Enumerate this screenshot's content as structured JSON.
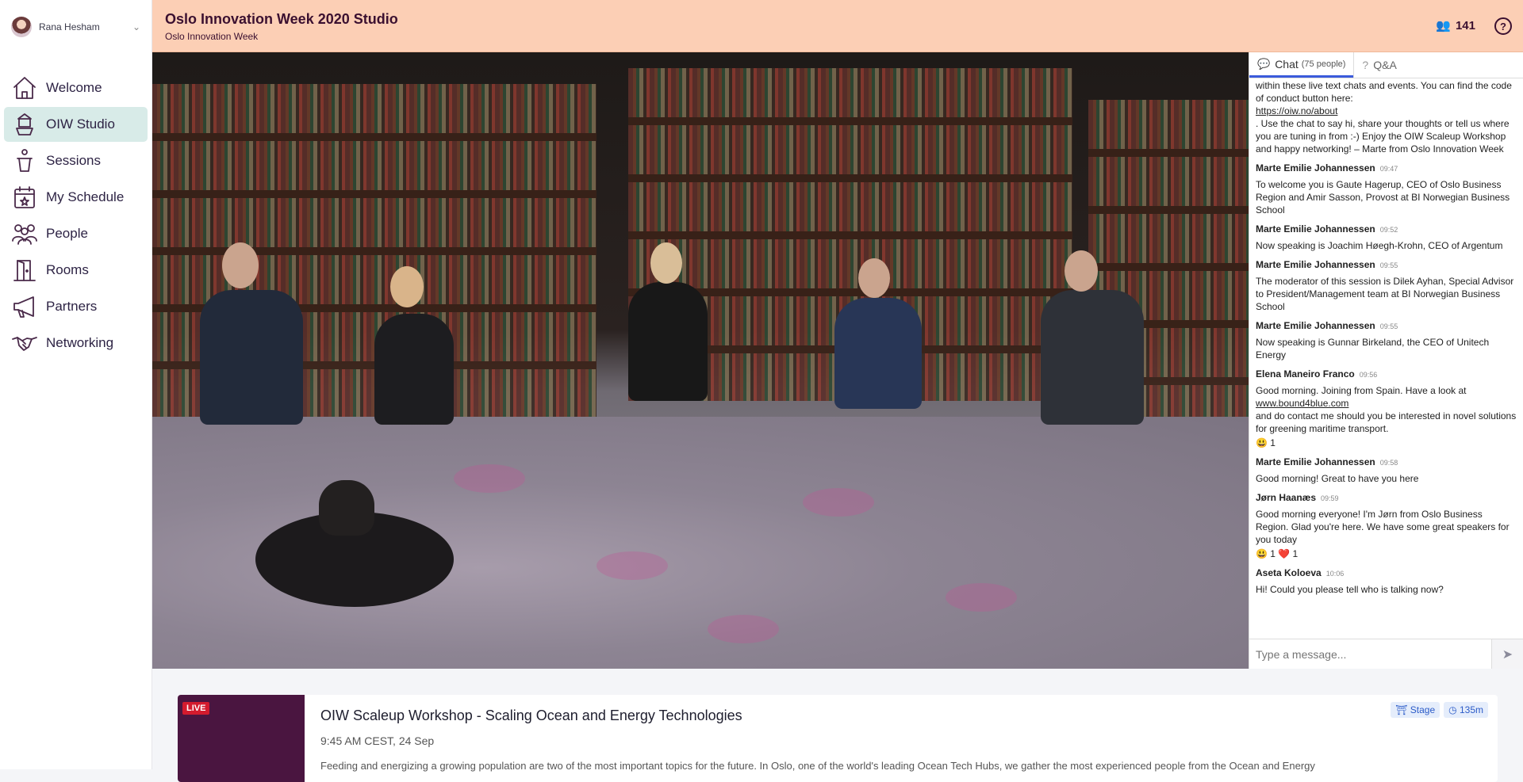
{
  "user": {
    "name": "Rana Hesham"
  },
  "nav": {
    "items": [
      {
        "label": "Welcome",
        "icon": "home-icon"
      },
      {
        "label": "OIW Studio",
        "icon": "stage-icon"
      },
      {
        "label": "Sessions",
        "icon": "podium-icon"
      },
      {
        "label": "My Schedule",
        "icon": "calendar-icon"
      },
      {
        "label": "People",
        "icon": "people-icon"
      },
      {
        "label": "Rooms",
        "icon": "door-icon"
      },
      {
        "label": "Partners",
        "icon": "megaphone-icon"
      },
      {
        "label": "Networking",
        "icon": "handshake-icon"
      }
    ]
  },
  "header": {
    "title": "Oslo Innovation Week 2020 Studio",
    "subtitle": "Oslo Innovation Week",
    "attendee_count": "141"
  },
  "chat": {
    "tab_chat": "Chat",
    "tab_chat_count": "(75 people)",
    "tab_qa": "Q&A",
    "intro": {
      "text_before": "within these live text chats and events. You can find the code of conduct button here:",
      "link": "https://oiw.no/about",
      "text_after": ". Use the chat to say hi, share your thoughts or tell us where you are tuning in from :-) Enjoy the OIW Scaleup Workshop and happy networking! – Marte from Oslo Innovation Week"
    },
    "messages": [
      {
        "author": "Marte Emilie Johannessen",
        "time": "09:47",
        "text": "To welcome you is Gaute Hagerup, CEO of Oslo Business Region and Amir Sasson, Provost at BI Norwegian Business School"
      },
      {
        "author": "Marte Emilie Johannessen",
        "time": "09:52",
        "text": "Now speaking is Joachim Høegh-Krohn, CEO of Argentum"
      },
      {
        "author": "Marte Emilie Johannessen",
        "time": "09:55",
        "text": "The moderator of this session is Dilek Ayhan, Special Advisor to President/Management team at BI Norwegian Business School"
      },
      {
        "author": "Marte Emilie Johannessen",
        "time": "09:55",
        "text": "Now speaking is Gunnar Birkeland, the CEO of Unitech Energy"
      }
    ],
    "elena": {
      "author": "Elena Maneiro Franco",
      "time": "09:56",
      "text_before": "Good morning. Joining from Spain. Have a look at",
      "link": "www.bound4blue.com",
      "text_after": "and do contact me should you be interested in novel solutions for greening maritime transport.",
      "reaction": "😃 1"
    },
    "marte_last": {
      "author": "Marte Emilie Johannessen",
      "time": "09:58",
      "text": "Good morning! Great to have you here"
    },
    "jorn": {
      "author": "Jørn Haanæs",
      "time": "09:59",
      "text": "Good morning everyone! I'm Jørn from Oslo Business Region. Glad you're here. We have some great speakers for you today",
      "reactions": "😃 1 ❤️ 1"
    },
    "aseta": {
      "author": "Aseta Koloeva",
      "time": "10:06",
      "text": "Hi! Could you please tell who is talking now?"
    },
    "input_placeholder": "Type a message..."
  },
  "session": {
    "live_label": "LIVE",
    "title": "OIW Scaleup Workshop - Scaling Ocean and Energy Technologies",
    "time": "9:45 AM CEST, 24 Sep",
    "description": "Feeding and energizing a growing population are two of the most important topics for the future. In Oslo, one of the world's leading Ocean Tech Hubs, we gather the most experienced people from the Ocean and Energy",
    "badge_stage": "Stage",
    "badge_duration": "135m"
  },
  "colors": {
    "header_bg": "#fccfb5",
    "active_nav": "#d8ebe8",
    "live_red": "#d31b2e",
    "accent_blue": "#3b5bdb"
  }
}
